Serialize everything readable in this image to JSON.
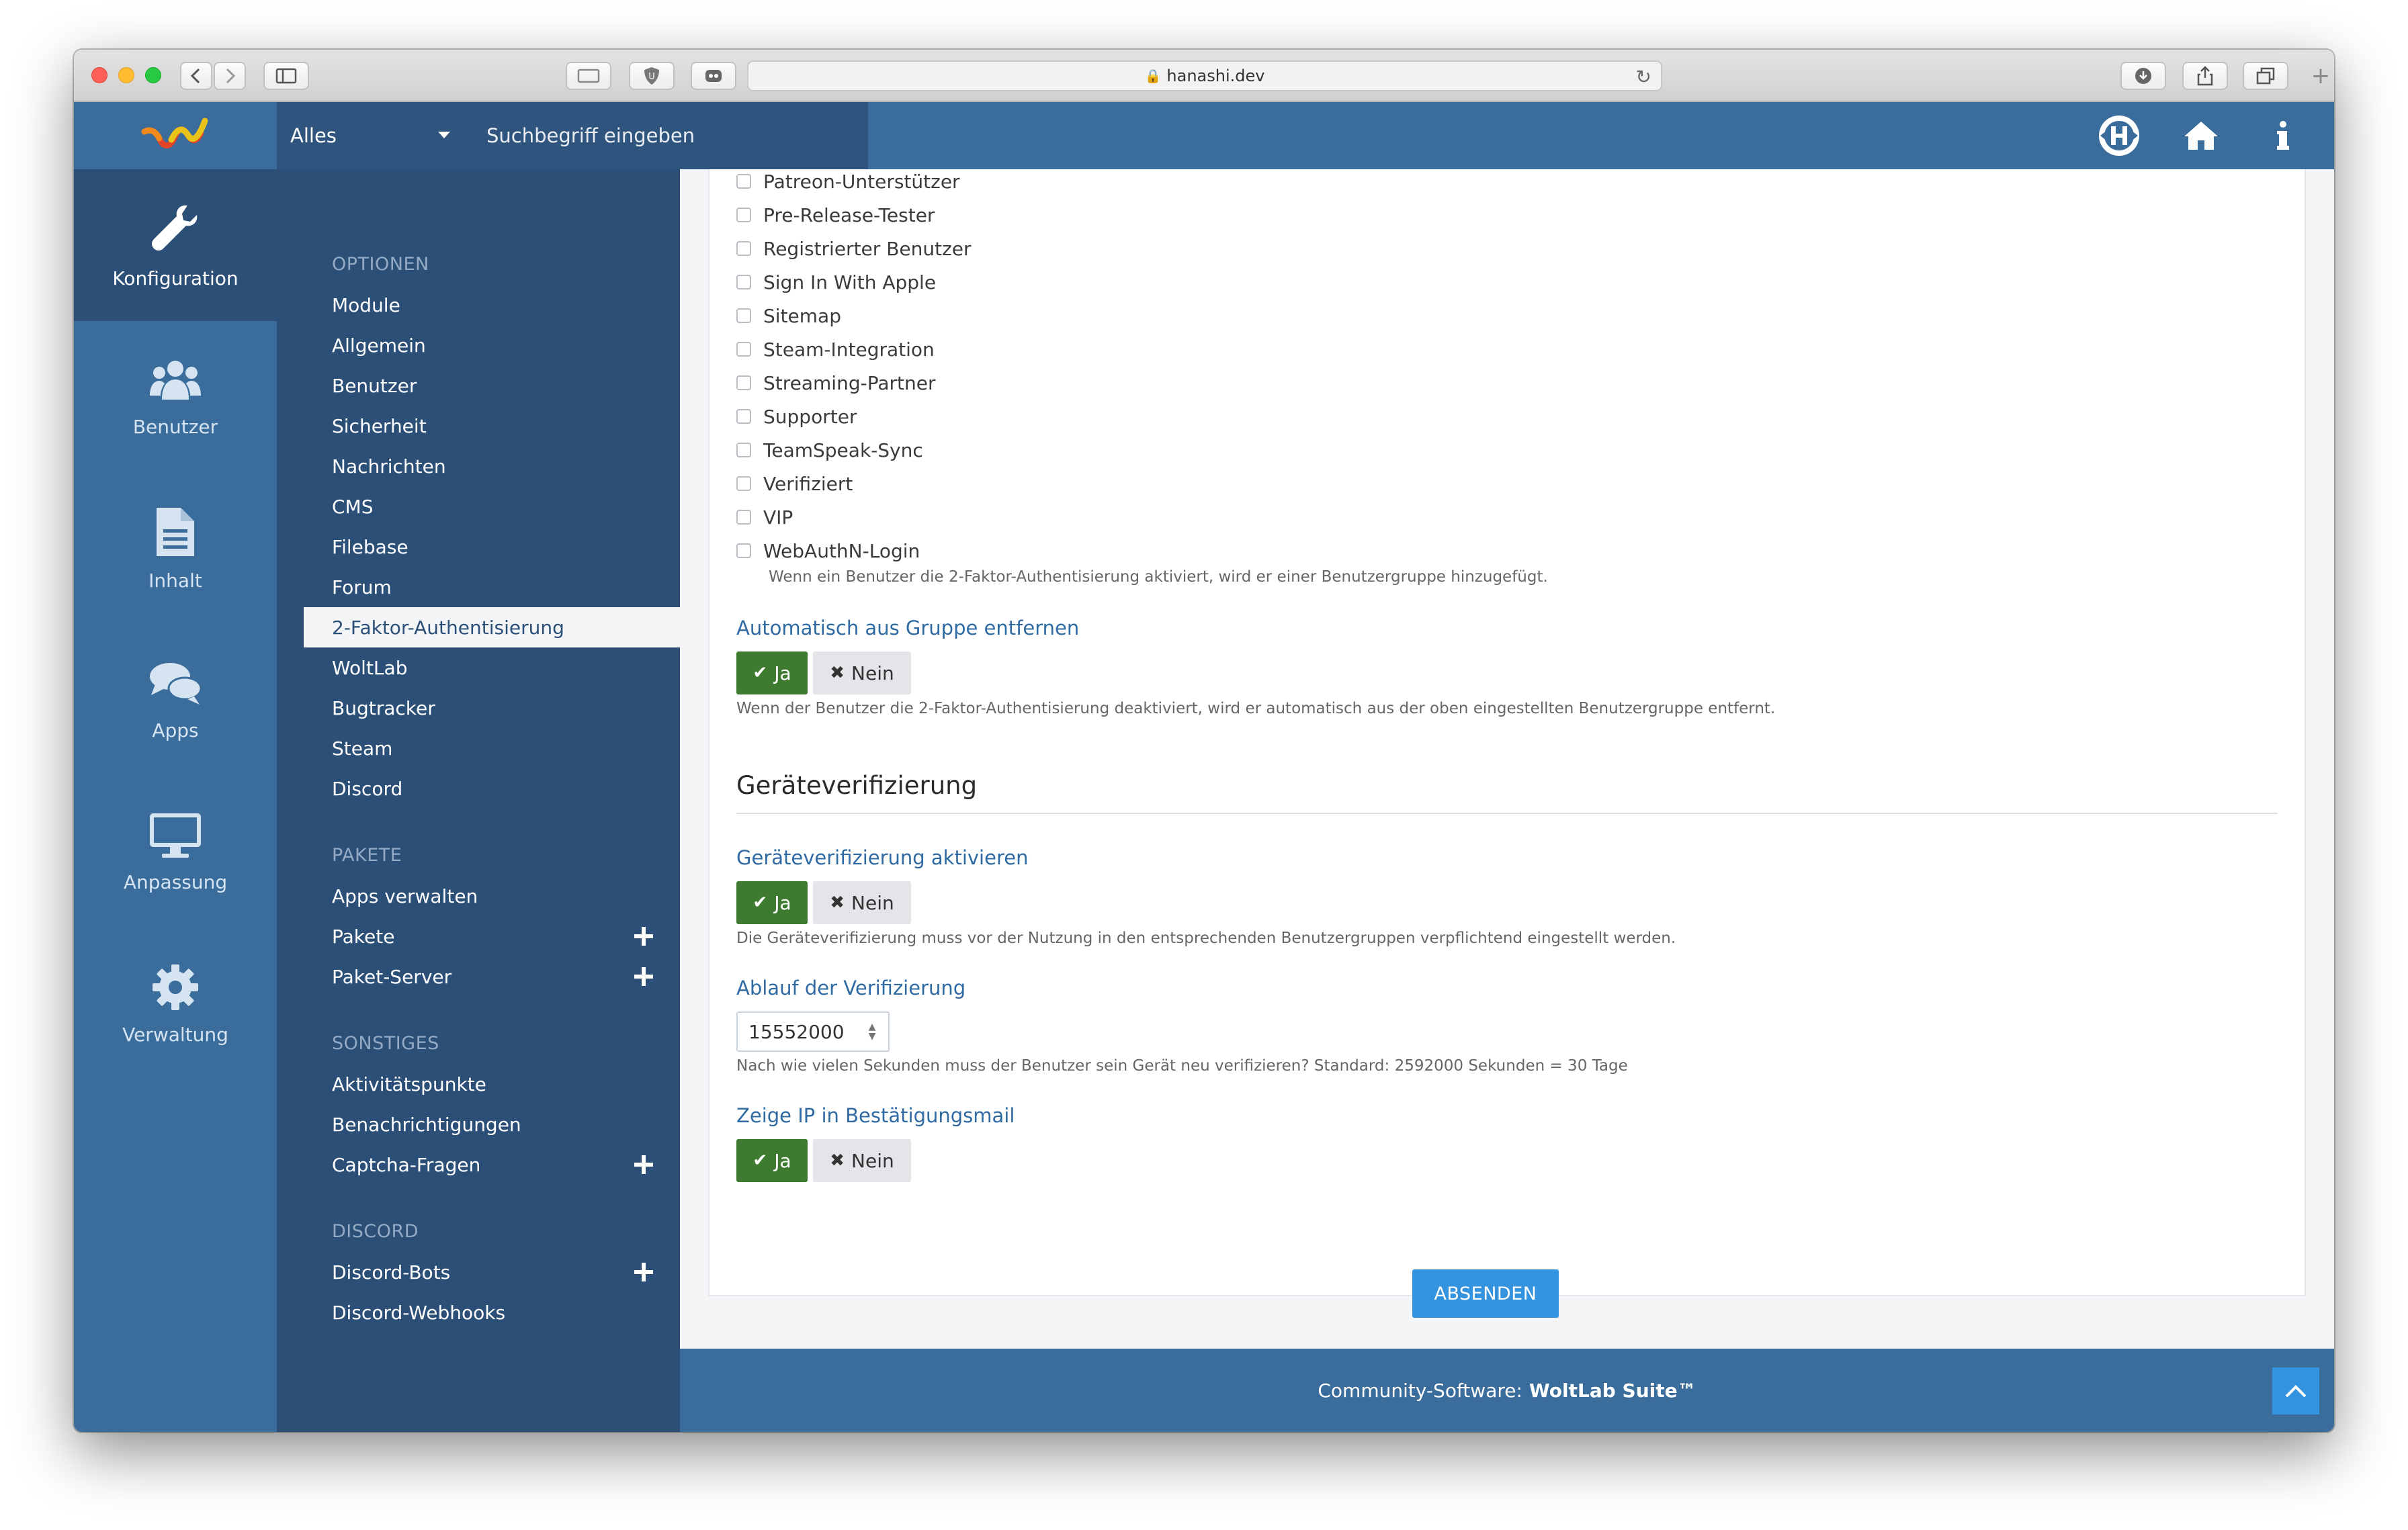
{
  "browser": {
    "url": "hanashi.dev"
  },
  "header": {
    "search_scope": "Alles",
    "search_placeholder": "Suchbegriff eingeben"
  },
  "rail": {
    "items": [
      {
        "label": "Konfiguration",
        "icon": "wrench-icon",
        "active": true
      },
      {
        "label": "Benutzer",
        "icon": "users-icon"
      },
      {
        "label": "Inhalt",
        "icon": "document-icon"
      },
      {
        "label": "Apps",
        "icon": "comments-icon"
      },
      {
        "label": "Anpassung",
        "icon": "monitor-icon"
      },
      {
        "label": "Verwaltung",
        "icon": "gear-icon"
      }
    ]
  },
  "menu": {
    "sections": [
      {
        "title": "OPTIONEN",
        "items": [
          "Module",
          "Allgemein",
          "Benutzer",
          "Sicherheit",
          "Nachrichten",
          "CMS",
          "Filebase",
          "Forum",
          "2-Faktor-Authentisierung",
          "WoltLab",
          "Bugtracker",
          "Steam",
          "Discord"
        ]
      },
      {
        "title": "PAKETE",
        "items": [
          "Apps verwalten",
          "Pakete",
          "Paket-Server"
        ]
      },
      {
        "title": "SONSTIGES",
        "items": [
          "Aktivitätspunkte",
          "Benachrichtigungen",
          "Captcha-Fragen"
        ]
      },
      {
        "title": "DISCORD",
        "items": [
          "Discord-Bots",
          "Discord-Webhooks"
        ]
      }
    ],
    "active_item": "2-Faktor-Authentisierung"
  },
  "groups": {
    "checkboxes": [
      "Patreon-Unterstützer",
      "Pre-Release-Tester",
      "Registrierter Benutzer",
      "Sign In With Apple",
      "Sitemap",
      "Steam-Integration",
      "Streaming-Partner",
      "Supporter",
      "TeamSpeak-Sync",
      "Verifiziert",
      "VIP",
      "WebAuthN-Login"
    ],
    "description": "Wenn ein Benutzer die 2-Faktor-Authentisierung aktiviert, wird er einer Benutzergruppe hinzugefügt."
  },
  "auto_remove": {
    "label": "Automatisch aus Gruppe entfernen",
    "yes": "Ja",
    "no": "Nein",
    "description": "Wenn der Benutzer die 2-Faktor-Authentisierung deaktiviert, wird er automatisch aus der oben eingestellten Benutzergruppe entfernt."
  },
  "device_section": {
    "title": "Geräteverifizierung",
    "enable": {
      "label": "Geräteverifizierung aktivieren",
      "yes": "Ja",
      "no": "Nein",
      "description": "Die Geräteverifizierung muss vor der Nutzung in den entsprechenden Benutzergruppen verpflichtend eingestellt werden."
    },
    "expiry": {
      "label": "Ablauf der Verifizierung",
      "value": "15552000",
      "description": "Nach wie vielen Sekunden muss der Benutzer sein Gerät neu verifizieren? Standard: 2592000 Sekunden = 30 Tage"
    },
    "show_ip": {
      "label": "Zeige IP in Bestätigungsmail",
      "yes": "Ja",
      "no": "Nein"
    }
  },
  "submit_label": "ABSENDEN",
  "footer": {
    "prefix": "Community-Software: ",
    "brand": "WoltLab Suite™"
  },
  "colors": {
    "header": "#3a6d9c",
    "menu": "#2c4f78",
    "yes_button": "#3e7b31",
    "submit": "#3493de",
    "label": "#2f6aa3"
  }
}
